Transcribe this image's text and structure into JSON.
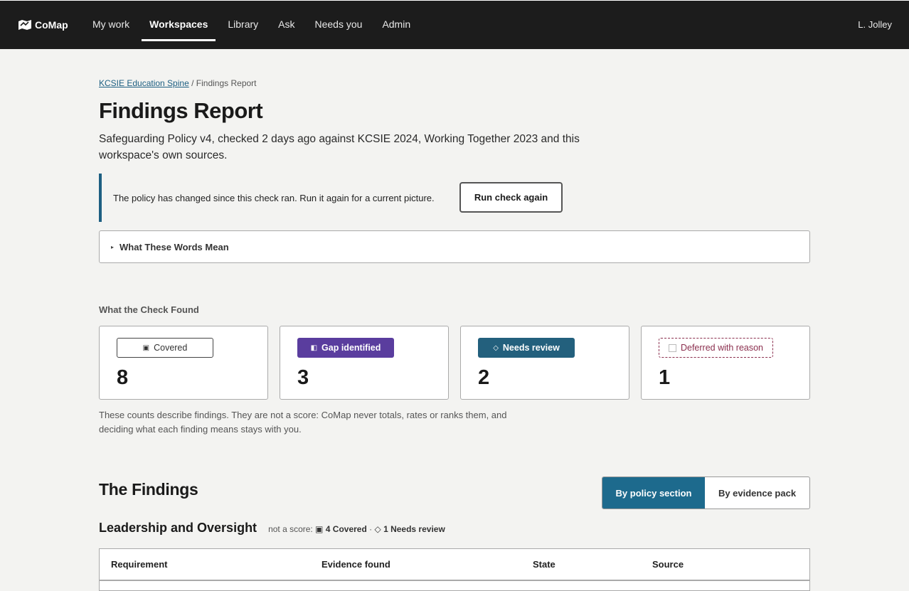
{
  "app": {
    "name": "CoMap",
    "user": "L. Jolley"
  },
  "nav": {
    "items": [
      {
        "label": "My work"
      },
      {
        "label": "Workspaces"
      },
      {
        "label": "Library"
      },
      {
        "label": "Ask"
      },
      {
        "label": "Needs you"
      },
      {
        "label": "Admin"
      }
    ],
    "active": "Workspaces"
  },
  "breadcrumb": {
    "parent": "KCSIE Education Spine",
    "separator": "/",
    "current": "Findings Report"
  },
  "page": {
    "title": "Findings Report",
    "subtitle": "Safeguarding Policy v4, checked 2 days ago against KCSIE 2024, Working Together 2023 and this workspace's own sources."
  },
  "notice": {
    "text": "The policy has changed since this check ran. Run it again for a current picture.",
    "button": "Run check again",
    "accent": "#1d5f82"
  },
  "glossary": {
    "label": "What These Words Mean"
  },
  "summary": {
    "heading": "What the Check Found",
    "cards": [
      {
        "label": "Covered",
        "count": "8",
        "glyph": "▣",
        "icon": "covered-icon"
      },
      {
        "label": "Gap identified",
        "count": "3",
        "glyph": "◧",
        "icon": "gap-icon",
        "color": "#5a3d9e"
      },
      {
        "label": "Needs review",
        "count": "2",
        "glyph": "◇",
        "icon": "review-icon",
        "color": "#23607d"
      },
      {
        "label": "Deferred with reason",
        "count": "1",
        "icon": "deferred-icon",
        "color": "#8b2f4e"
      }
    ],
    "caption": "These counts describe findings. They are not a score: CoMap never totals, rates or ranks them, and deciding what each finding means stays with you."
  },
  "findings": {
    "title": "The Findings",
    "view_toggle": {
      "on": "By policy section",
      "off": "By evidence pack"
    },
    "group": {
      "title": "Leadership and Oversight",
      "meta_prefix": "not a score:",
      "covered": "▣ 4 Covered",
      "sep": "·",
      "review": "◇ 1 Needs review"
    },
    "columns": [
      "Requirement",
      "Evidence found",
      "State",
      "Source"
    ]
  }
}
